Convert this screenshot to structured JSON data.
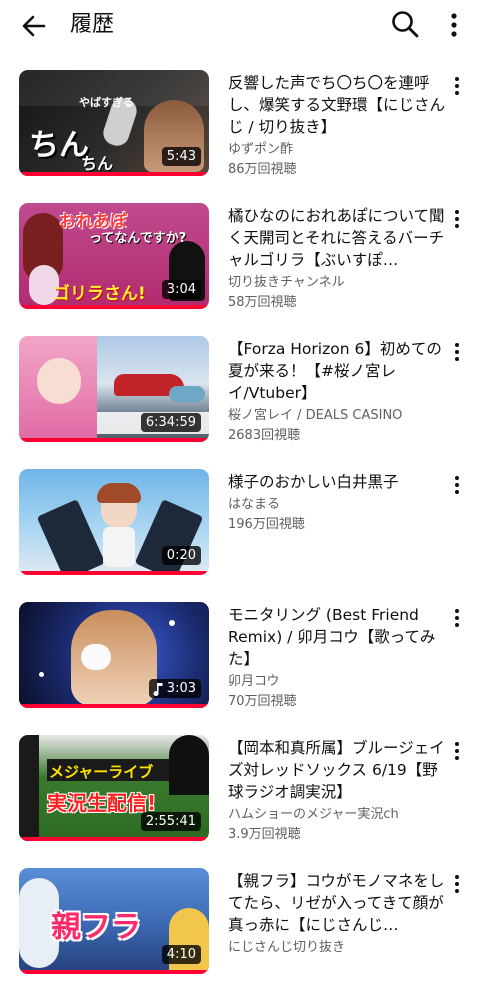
{
  "header": {
    "title": "履歴"
  },
  "videos": [
    {
      "title": "反響した声でち〇ち〇を連呼し、爆笑する文野環【にじさんじ / 切り抜き】",
      "channel": "ゆずポン酢",
      "views": "86万回視聴",
      "duration": "5:43",
      "thumb_text": "ちん",
      "thumb_text2": "ちん",
      "thumb_text3": "やばすぎる"
    },
    {
      "title": "橘ひなのにおれあぽについて聞く天開司とそれに答えるバーチャルゴリラ【ぶいすぽ…",
      "channel": "切り抜きチャンネル",
      "views": "58万回視聴",
      "duration": "3:04",
      "thumb_text": "おれあぽ",
      "thumb_text2": "ってなんですか?",
      "thumb_text3": "ゴリラさん!"
    },
    {
      "title": "【Forza Horizon 6】初めての夏が来る！【#桜ノ宮レイ/Vtuber】",
      "channel": "桜ノ宮レイ / DEALS CASINO",
      "views": "2683回視聴",
      "duration": "6:34:59"
    },
    {
      "title": "様子のおかしい白井黒子",
      "channel": "はなまる",
      "views": "196万回視聴",
      "duration": "0:20"
    },
    {
      "title": "モニタリング (Best Friend Remix) / 卯月コウ【歌ってみた】",
      "channel": "卯月コウ",
      "views": "70万回視聴",
      "duration": "3:03"
    },
    {
      "title": "【岡本和真所属】ブルージェイズ対レッドソックス 6/19【野球ラジオ調実況】",
      "channel": "ハムショーのメジャー実況ch",
      "views": "3.9万回視聴",
      "duration": "2:55:41",
      "thumb_text": "メジャーライブ",
      "thumb_text2": "実況生配信!"
    },
    {
      "title": "【親フラ】コウがモノマネをしてたら、リゼが入ってきて顔が真っ赤に【にじさんじ…",
      "channel": "にじさんじ切り抜き",
      "views": "",
      "duration": "4:10",
      "thumb_text": "親フラ"
    }
  ]
}
